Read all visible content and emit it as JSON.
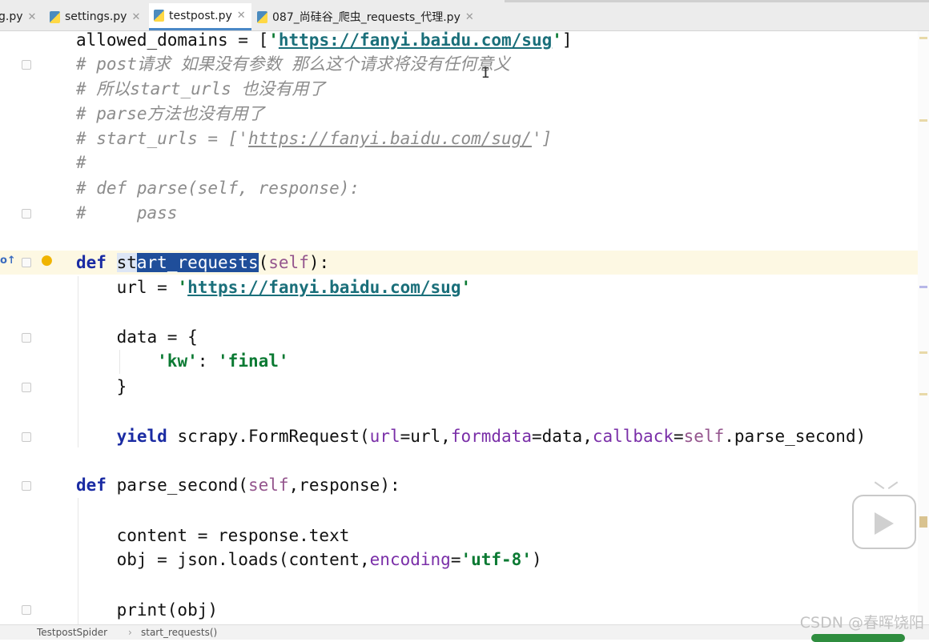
{
  "tabs": [
    {
      "label": "g.py"
    },
    {
      "label": "settings.py"
    },
    {
      "label": "testpost.py",
      "active": true
    },
    {
      "label": "087_尚硅谷_爬虫_requests_代理.py"
    }
  ],
  "code": {
    "l1": {
      "a": "allowed_domains = [",
      "q1": "'",
      "url": "https://fanyi.baidu.com/sug",
      "q2": "'",
      "b": "]"
    },
    "l2": "# post请求 如果没有参数 那么这个请求将没有任何意义",
    "l3": "# 所以start_urls 也没有用了",
    "l4": "# parse方法也没有用了",
    "l5": {
      "a": "# start_urls = ['",
      "url": "https://fanyi.baidu.com/sug/",
      "b": "']"
    },
    "l6": "#",
    "l7": "# def parse(self, response):",
    "l8": "#     pass",
    "l9": {
      "kw": "def",
      "sp": " ",
      "pre": "st",
      "sel": "art_requests",
      "open": "(",
      "self": "self",
      "close": "):"
    },
    "l10": {
      "a": "    url = ",
      "q1": "'",
      "url": "https://fanyi.baidu.com/sug",
      "q2": "'"
    },
    "l11": "    data = {",
    "l12": {
      "ind": "        ",
      "k": "'kw'",
      "colon": ": ",
      "v": "'final'"
    },
    "l13": "    }",
    "l14": {
      "ind": "    ",
      "kw": "yield",
      "a": " scrapy.FormRequest(",
      "p1": "url",
      "b": "=url,",
      "p2": "formdata",
      "c": "=data,",
      "p3": "callback",
      "d": "=",
      "self": "self",
      "e": ".parse_second)"
    },
    "l15": {
      "kw": "def",
      "a": " parse_second(",
      "self": "self",
      "b": ",response):"
    },
    "l16": "    content = response.text",
    "l17": {
      "a": "    obj = json.loads(content,",
      "p": "encoding",
      "b": "=",
      "s": "'utf-8'",
      "c": ")"
    },
    "l18": {
      "ind": "    ",
      "a": "print(obj)"
    }
  },
  "breadcrumb": {
    "class_name": "TestpostSpider",
    "separator": "›",
    "method_name": "start_requests()"
  },
  "watermark": "CSDN @春晖饶阳",
  "icons": {
    "bulb": "lightbulb-icon",
    "override": "override-marker-icon",
    "play": "play-icon"
  },
  "colors": {
    "keyword": "#1a2ba3",
    "string": "#0b7a33",
    "comment": "#8c8c8c",
    "selection": "#1f4e9a",
    "current_line": "#fdf8e3"
  }
}
